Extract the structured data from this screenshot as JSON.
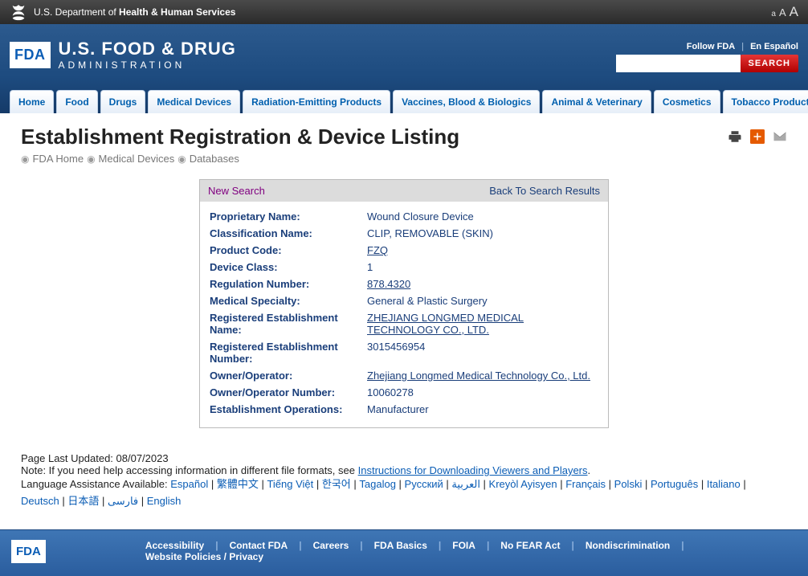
{
  "topbar": {
    "dept_light": "U.S. Department of ",
    "dept_bold": "Health & Human Services"
  },
  "banner": {
    "fda_badge": "FDA",
    "title_line1": "U.S. FOOD & DRUG",
    "title_line2": "ADMINISTRATION",
    "follow": "Follow FDA",
    "espanol": "En Español",
    "search_btn": "SEARCH"
  },
  "nav": {
    "home": "Home",
    "food": "Food",
    "drugs": "Drugs",
    "medical_devices": "Medical Devices",
    "radiation": "Radiation-Emitting Products",
    "vaccines": "Vaccines, Blood & Biologics",
    "animal": "Animal & Veterinary",
    "cosmetics": "Cosmetics",
    "tobacco": "Tobacco Products"
  },
  "page": {
    "title": "Establishment Registration & Device Listing",
    "bc_fda": "FDA Home",
    "bc_md": "Medical Devices",
    "bc_db": "Databases"
  },
  "record_links": {
    "new_search": "New Search",
    "back": "Back To Search Results"
  },
  "record": {
    "labels": {
      "proprietary": "Proprietary Name:",
      "classification": "Classification Name:",
      "product_code": "Product Code:",
      "device_class": "Device Class:",
      "regulation": "Regulation Number:",
      "specialty": "Medical Specialty:",
      "reg_est_name": "Registered Establishment Name:",
      "reg_est_num": "Registered Establishment Number:",
      "owner": "Owner/Operator:",
      "owner_num": "Owner/Operator Number:",
      "est_ops": "Establishment Operations:"
    },
    "values": {
      "proprietary": "Wound Closure Device",
      "classification": "CLIP, REMOVABLE (SKIN)",
      "product_code": "FZQ",
      "device_class": "1",
      "regulation": "878.4320",
      "specialty": "General & Plastic Surgery",
      "reg_est_name": "ZHEJIANG LONGMED MEDICAL TECHNOLOGY CO., LTD.",
      "reg_est_num": "3015456954",
      "owner": "Zhejiang Longmed Medical Technology Co., Ltd.",
      "owner_num": "10060278",
      "est_ops": "Manufacturer"
    }
  },
  "meta": {
    "updated": "Page Last Updated: 08/07/2023",
    "note_prefix": "Note: If you need help accessing information in different file formats, see ",
    "note_link": "Instructions for Downloading Viewers and Players",
    "lang_prefix": "Language Assistance Available: ",
    "langs": [
      "Español",
      "繁體中文",
      "Tiếng Việt",
      "한국어",
      "Tagalog",
      "Русский",
      "العربية",
      "Kreyòl Ayisyen",
      "Français",
      "Polski",
      "Português",
      "Italiano",
      "Deutsch",
      "日本語",
      "فارسی",
      "English"
    ]
  },
  "footer": {
    "logo": "FDA",
    "links": [
      "Accessibility",
      "Contact FDA",
      "Careers",
      "FDA Basics",
      "FOIA",
      "No FEAR Act",
      "Nondiscrimination",
      "Website Policies / Privacy"
    ]
  }
}
